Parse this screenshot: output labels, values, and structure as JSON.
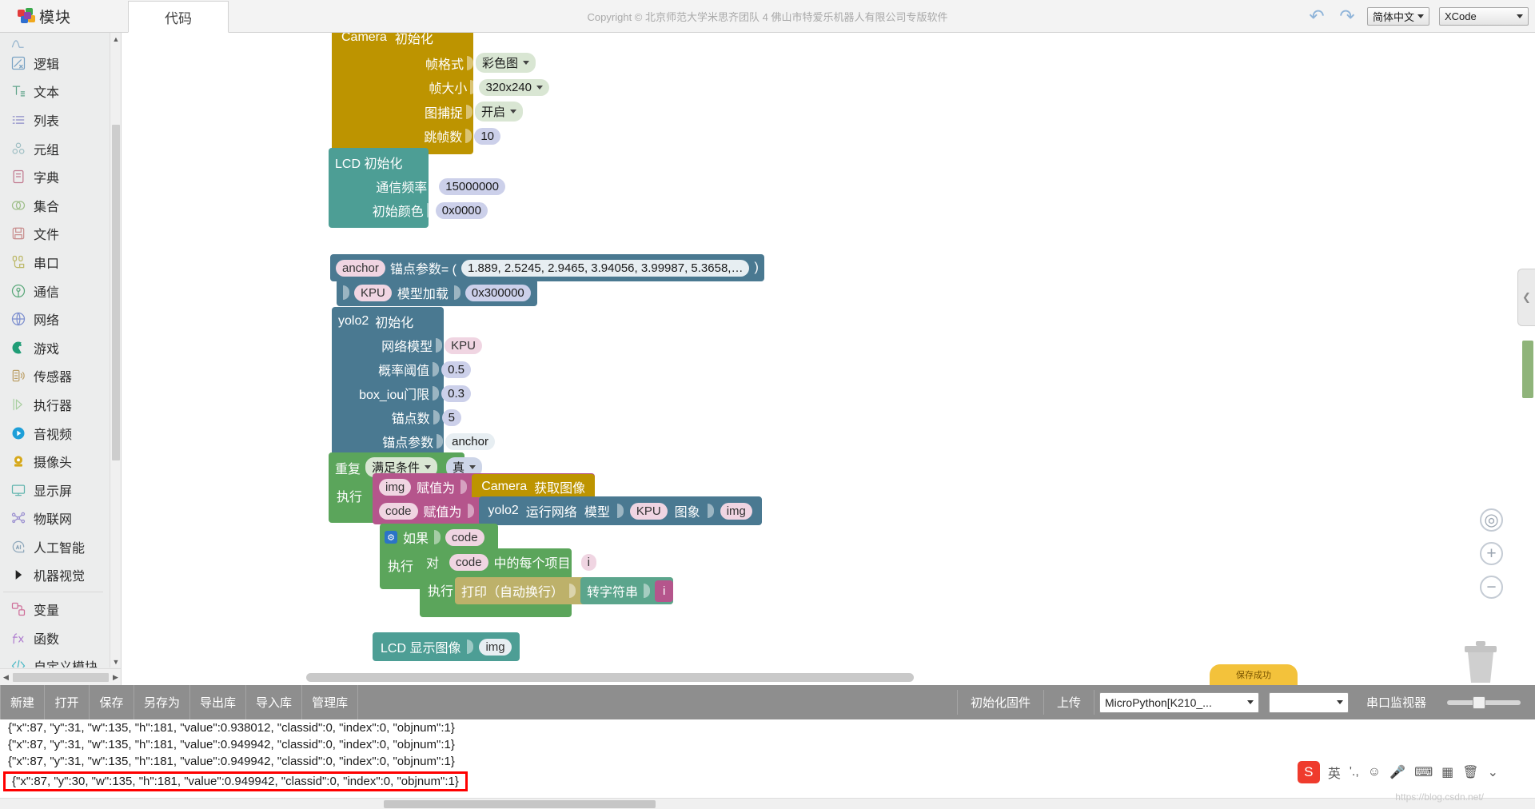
{
  "header": {
    "logo_label": "模块",
    "tabs": [
      {
        "label": "代码"
      }
    ],
    "copyright": "Copyright © 北京师范大学米思齐团队 4 佛山市特爱乐机器人有限公司专版软件",
    "undo_icon": "undo-icon",
    "redo_icon": "redo-icon",
    "language": "简体中文",
    "mode": "XCode"
  },
  "sidebar": {
    "items": [
      {
        "label": "逻辑",
        "icon": "logic-icon",
        "color": "#7aa3c4"
      },
      {
        "label": "文本",
        "icon": "text-icon",
        "color": "#5fa38a"
      },
      {
        "label": "列表",
        "icon": "list-icon",
        "color": "#8b8bc8"
      },
      {
        "label": "元组",
        "icon": "tuple-icon",
        "color": "#9fbfc4"
      },
      {
        "label": "字典",
        "icon": "dict-icon",
        "color": "#c1798f"
      },
      {
        "label": "集合",
        "icon": "set-icon",
        "color": "#9fbf8a"
      },
      {
        "label": "文件",
        "icon": "file-icon",
        "color": "#c98f8f"
      },
      {
        "label": "串口",
        "icon": "serial-icon",
        "color": "#bdb96a"
      },
      {
        "label": "通信",
        "icon": "comm-icon",
        "color": "#5aa87a"
      },
      {
        "label": "网络",
        "icon": "network-icon",
        "color": "#7d8fcf"
      },
      {
        "label": "游戏",
        "icon": "game-icon",
        "color": "#1f9d76"
      },
      {
        "label": "传感器",
        "icon": "sensor-icon",
        "color": "#bda16a"
      },
      {
        "label": "执行器",
        "icon": "actuator-icon",
        "color": "#a8cfa0"
      },
      {
        "label": "音视频",
        "icon": "media-icon",
        "color": "#1e9fd8"
      },
      {
        "label": "摄像头",
        "icon": "camera-icon",
        "color": "#d6a81a"
      },
      {
        "label": "显示屏",
        "icon": "display-icon",
        "color": "#62b5ae"
      },
      {
        "label": "物联网",
        "icon": "iot-icon",
        "color": "#9a8fd0"
      },
      {
        "label": "人工智能",
        "icon": "ai-icon",
        "color": "#8fa8bb"
      },
      {
        "label": "机器视觉",
        "icon": "triangle-right-icon",
        "color": "#222222"
      }
    ],
    "bottom_items": [
      {
        "label": "变量",
        "icon": "variable-icon",
        "color": "#cf6f9a"
      },
      {
        "label": "函数",
        "icon": "function-icon",
        "color": "#b07fd0"
      },
      {
        "label": "自定义模块",
        "icon": "code-tags-icon",
        "color": "#46b7c4"
      }
    ]
  },
  "blocks": {
    "camera_init": {
      "title_a": "Camera",
      "title_b": "初始化",
      "rows": [
        {
          "label": "帧格式",
          "value": "彩色图",
          "kind": "dropdown"
        },
        {
          "label": "帧大小",
          "value": "320x240",
          "kind": "dropdown"
        },
        {
          "label": "图捕捉",
          "value": "开启",
          "kind": "dropdown"
        },
        {
          "label": "跳帧数",
          "value": "10",
          "kind": "number"
        }
      ]
    },
    "lcd_init": {
      "title": "LCD 初始化",
      "rows": [
        {
          "label": "通信频率",
          "value": "15000000",
          "kind": "number"
        },
        {
          "label": "初始颜色",
          "value": "0x0000",
          "kind": "number"
        }
      ]
    },
    "anchor": {
      "var": "anchor",
      "label": "锚点参数= (",
      "value": "1.889, 2.5245, 2.9465, 3.94056, 3.99987, 5.3658,…",
      "tail": ")"
    },
    "kpu_load": {
      "var": "KPU",
      "label": "模型加载",
      "value": "0x300000"
    },
    "yolo2_init": {
      "title_a": "yolo2",
      "title_b": "初始化",
      "rows": [
        {
          "label": "网络模型",
          "value": "KPU",
          "kind": "var"
        },
        {
          "label": "概率阈值",
          "value": "0.5",
          "kind": "number"
        },
        {
          "label": "box_iou门限",
          "value": "0.3",
          "kind": "number"
        },
        {
          "label": "锚点数",
          "value": "5",
          "kind": "number"
        },
        {
          "label": "锚点参数",
          "value": "anchor",
          "kind": "text"
        }
      ]
    },
    "loop": {
      "keyword": "重复",
      "condition_mode": "满足条件",
      "condition_value": "真",
      "do_label": "执行"
    },
    "set_img": {
      "var": "img",
      "op": "赋值为",
      "value_a": "Camera",
      "value_b": "获取图像"
    },
    "set_code": {
      "var": "code",
      "op": "赋值为",
      "fn_a": "yolo2",
      "fn_b": "运行网络",
      "arg1_label": "模型",
      "arg1": "KPU",
      "arg2_label": "图象",
      "arg2": "img"
    },
    "if_block": {
      "gear_icon": "gear-icon",
      "keyword": "如果",
      "value": "code",
      "do_label": "执行"
    },
    "foreach": {
      "prefix": "对",
      "list": "code",
      "mid": "中的每个项目",
      "itemvar": "i",
      "do_label": "执行"
    },
    "print": {
      "label": "打印（自动换行）",
      "cast_label": "转字符串",
      "arg": "i"
    },
    "lcd_show": {
      "label": "LCD 显示图像",
      "arg": "img"
    },
    "badge": "保存成功"
  },
  "canvas_controls": {
    "center_icon": "crosshair-icon",
    "zoom_in_icon": "plus-icon",
    "zoom_out_icon": "minus-icon",
    "trash_icon": "trash-icon",
    "collapse_icon": "chevron-left-icon"
  },
  "bottombar": {
    "buttons": [
      "新建",
      "打开",
      "保存",
      "另存为",
      "导出库",
      "导入库",
      "管理库"
    ],
    "firmware_label": "初始化固件",
    "upload_label": "上传",
    "device": "MicroPython[K210_...",
    "port": "",
    "monitor_label": "串口监视器"
  },
  "console": {
    "lines": [
      "{\"x\":87, \"y\":31, \"w\":135, \"h\":181, \"value\":0.938012, \"classid\":0, \"index\":0, \"objnum\":1}",
      "{\"x\":87, \"y\":31, \"w\":135, \"h\":181, \"value\":0.949942, \"classid\":0, \"index\":0, \"objnum\":1}",
      "{\"x\":87, \"y\":31, \"w\":135, \"h\":181, \"value\":0.949942, \"classid\":0, \"index\":0, \"objnum\":1}"
    ],
    "highlighted_line": "{\"x\":87, \"y\":30, \"w\":135, \"h\":181, \"value\":0.949942, \"classid\":0, \"index\":0, \"objnum\":1}",
    "highlight_color": "#ff0000"
  },
  "ime": {
    "logo": "S",
    "items": [
      "英",
      "'.,",
      "☺",
      "🎤",
      "⌨",
      "▦",
      "🗑",
      "⌄"
    ]
  },
  "watermark": "https://blog.csdn.net/",
  "colors": {
    "camera_block": "#bd9400",
    "lcd_block": "#4d9e95",
    "vision_block": "#4a7991",
    "loop_block": "#5ba55b",
    "variable_block": "#b5558c",
    "text_block": "#5ba58c",
    "print_block": "#bdb16a",
    "bottombar": "#8e8e8e"
  }
}
